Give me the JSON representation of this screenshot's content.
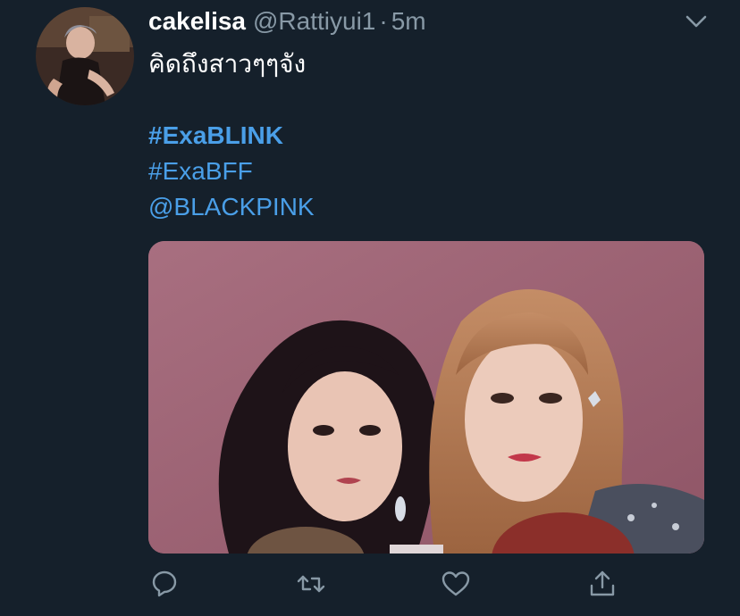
{
  "tweet": {
    "display_name": "cakelisa",
    "handle": "@Rattiyui1",
    "separator": "·",
    "time": "5m",
    "text_line": "คิดถึงสาวๆๆจัง",
    "hashtag_1": "#ExaBLINK",
    "hashtag_2": "#ExaBFF",
    "mention": "@BLACKPINK",
    "more_icon": "chevron-down-icon"
  },
  "actions": {
    "reply_icon": "reply-icon",
    "retweet_icon": "retweet-icon",
    "like_icon": "heart-icon",
    "share_icon": "share-icon"
  },
  "colors": {
    "background": "#15202b",
    "secondary_text": "#8899a6",
    "link": "#4a9fe8",
    "media_backdrop": "#a06677"
  }
}
